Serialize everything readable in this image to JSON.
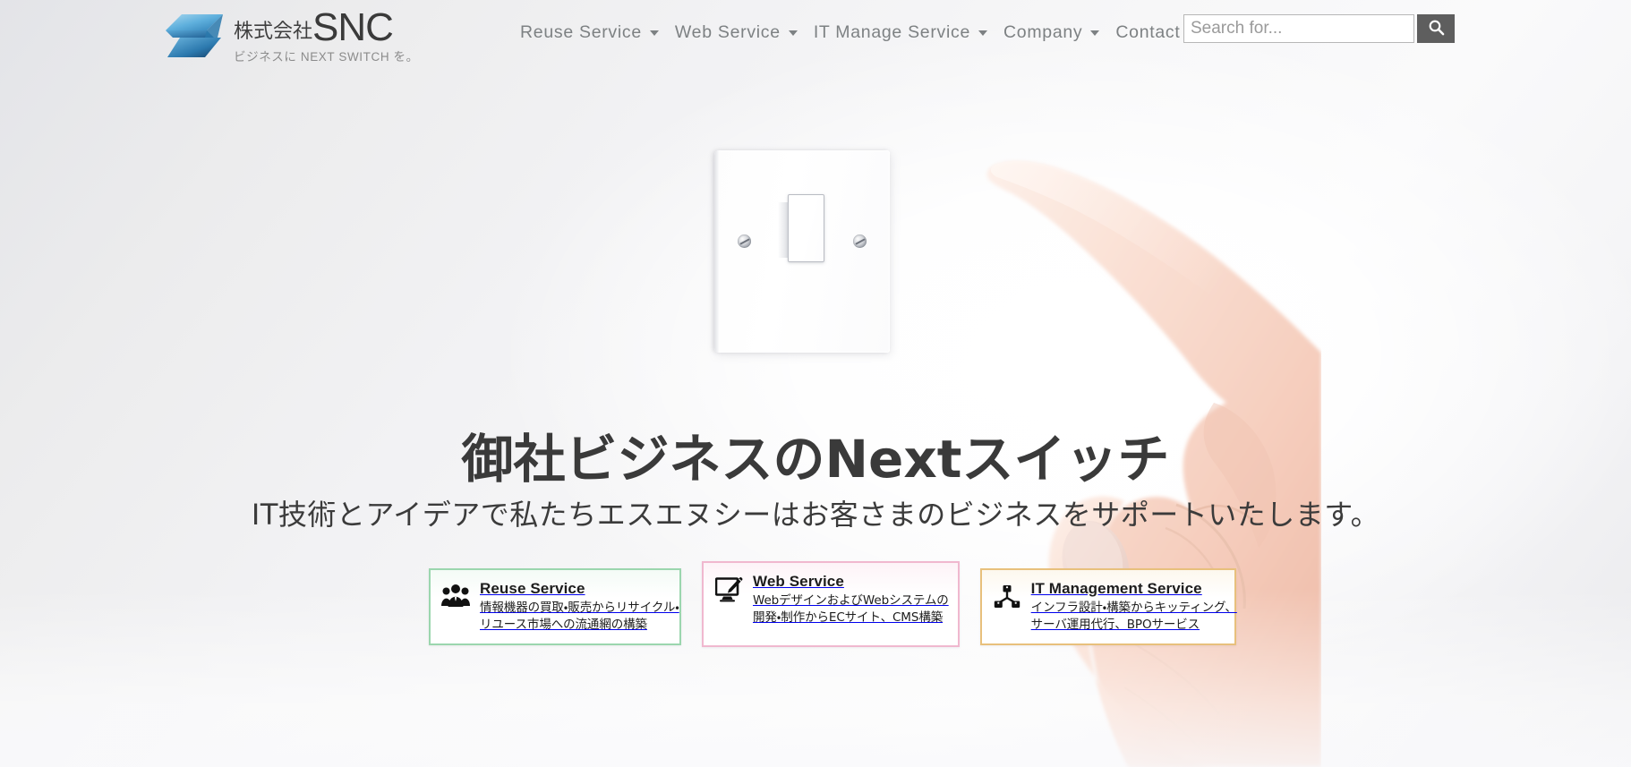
{
  "header": {
    "logo": {
      "company_prefix": "株式会社",
      "company_name": "SNC",
      "tagline": "ビジネスに NEXT SWITCH を。",
      "mark_icon": "snc-chevron-logo-icon"
    },
    "nav": [
      {
        "label": "Reuse Service",
        "has_dropdown": true,
        "name": "reuse-service"
      },
      {
        "label": "Web Service",
        "has_dropdown": true,
        "name": "web-service"
      },
      {
        "label": "IT Manage Service",
        "has_dropdown": true,
        "name": "it-manage-service"
      },
      {
        "label": "Company",
        "has_dropdown": true,
        "name": "company"
      },
      {
        "label": "Contact",
        "has_dropdown": false,
        "name": "contact"
      }
    ],
    "search": {
      "value": "",
      "placeholder": "Search for...",
      "button_icon": "search-icon",
      "button_color": "#5e5e5e"
    }
  },
  "hero": {
    "headline": "御社ビジネスのNextスイッチ",
    "subheadline": "IT技術とアイデアで私たちエスエヌシーはお客さまのビジネスをサポートいたします。",
    "images": {
      "switch_plate": "light-switch-plate-image",
      "hand": "pointing-hand-image"
    }
  },
  "service_cards": [
    {
      "id": "reuse",
      "icon": "people-group-icon",
      "title": "Reuse Service",
      "desc_line1": "情報機器の買取・販売からリサイクル・",
      "desc_line2": "リユース市場への流通網の構築",
      "border_color": "#9bd6ae"
    },
    {
      "id": "web",
      "icon": "monitor-pen-icon",
      "title": "Web Service",
      "desc_line1": "WebデザインおよびWebシステムの",
      "desc_line2": "開発・制作からECサイト、CMS構築",
      "border_color": "#f0b8cf"
    },
    {
      "id": "it",
      "icon": "network-nodes-icon",
      "title": "IT Management Service",
      "desc_line1": "インフラ設計・構築からキッティング、",
      "desc_line2": "サーバ運用代行、BPOサービス",
      "border_color": "#e8c07c"
    }
  ],
  "colors": {
    "page_background_light": "#f5f5f7",
    "page_background_dark": "#e3e4e8",
    "nav_text": "#7d8183",
    "heading_text": "#3a3a3a",
    "logo_blue_light": "#6fb9e3",
    "logo_blue_dark": "#1d5b94"
  }
}
